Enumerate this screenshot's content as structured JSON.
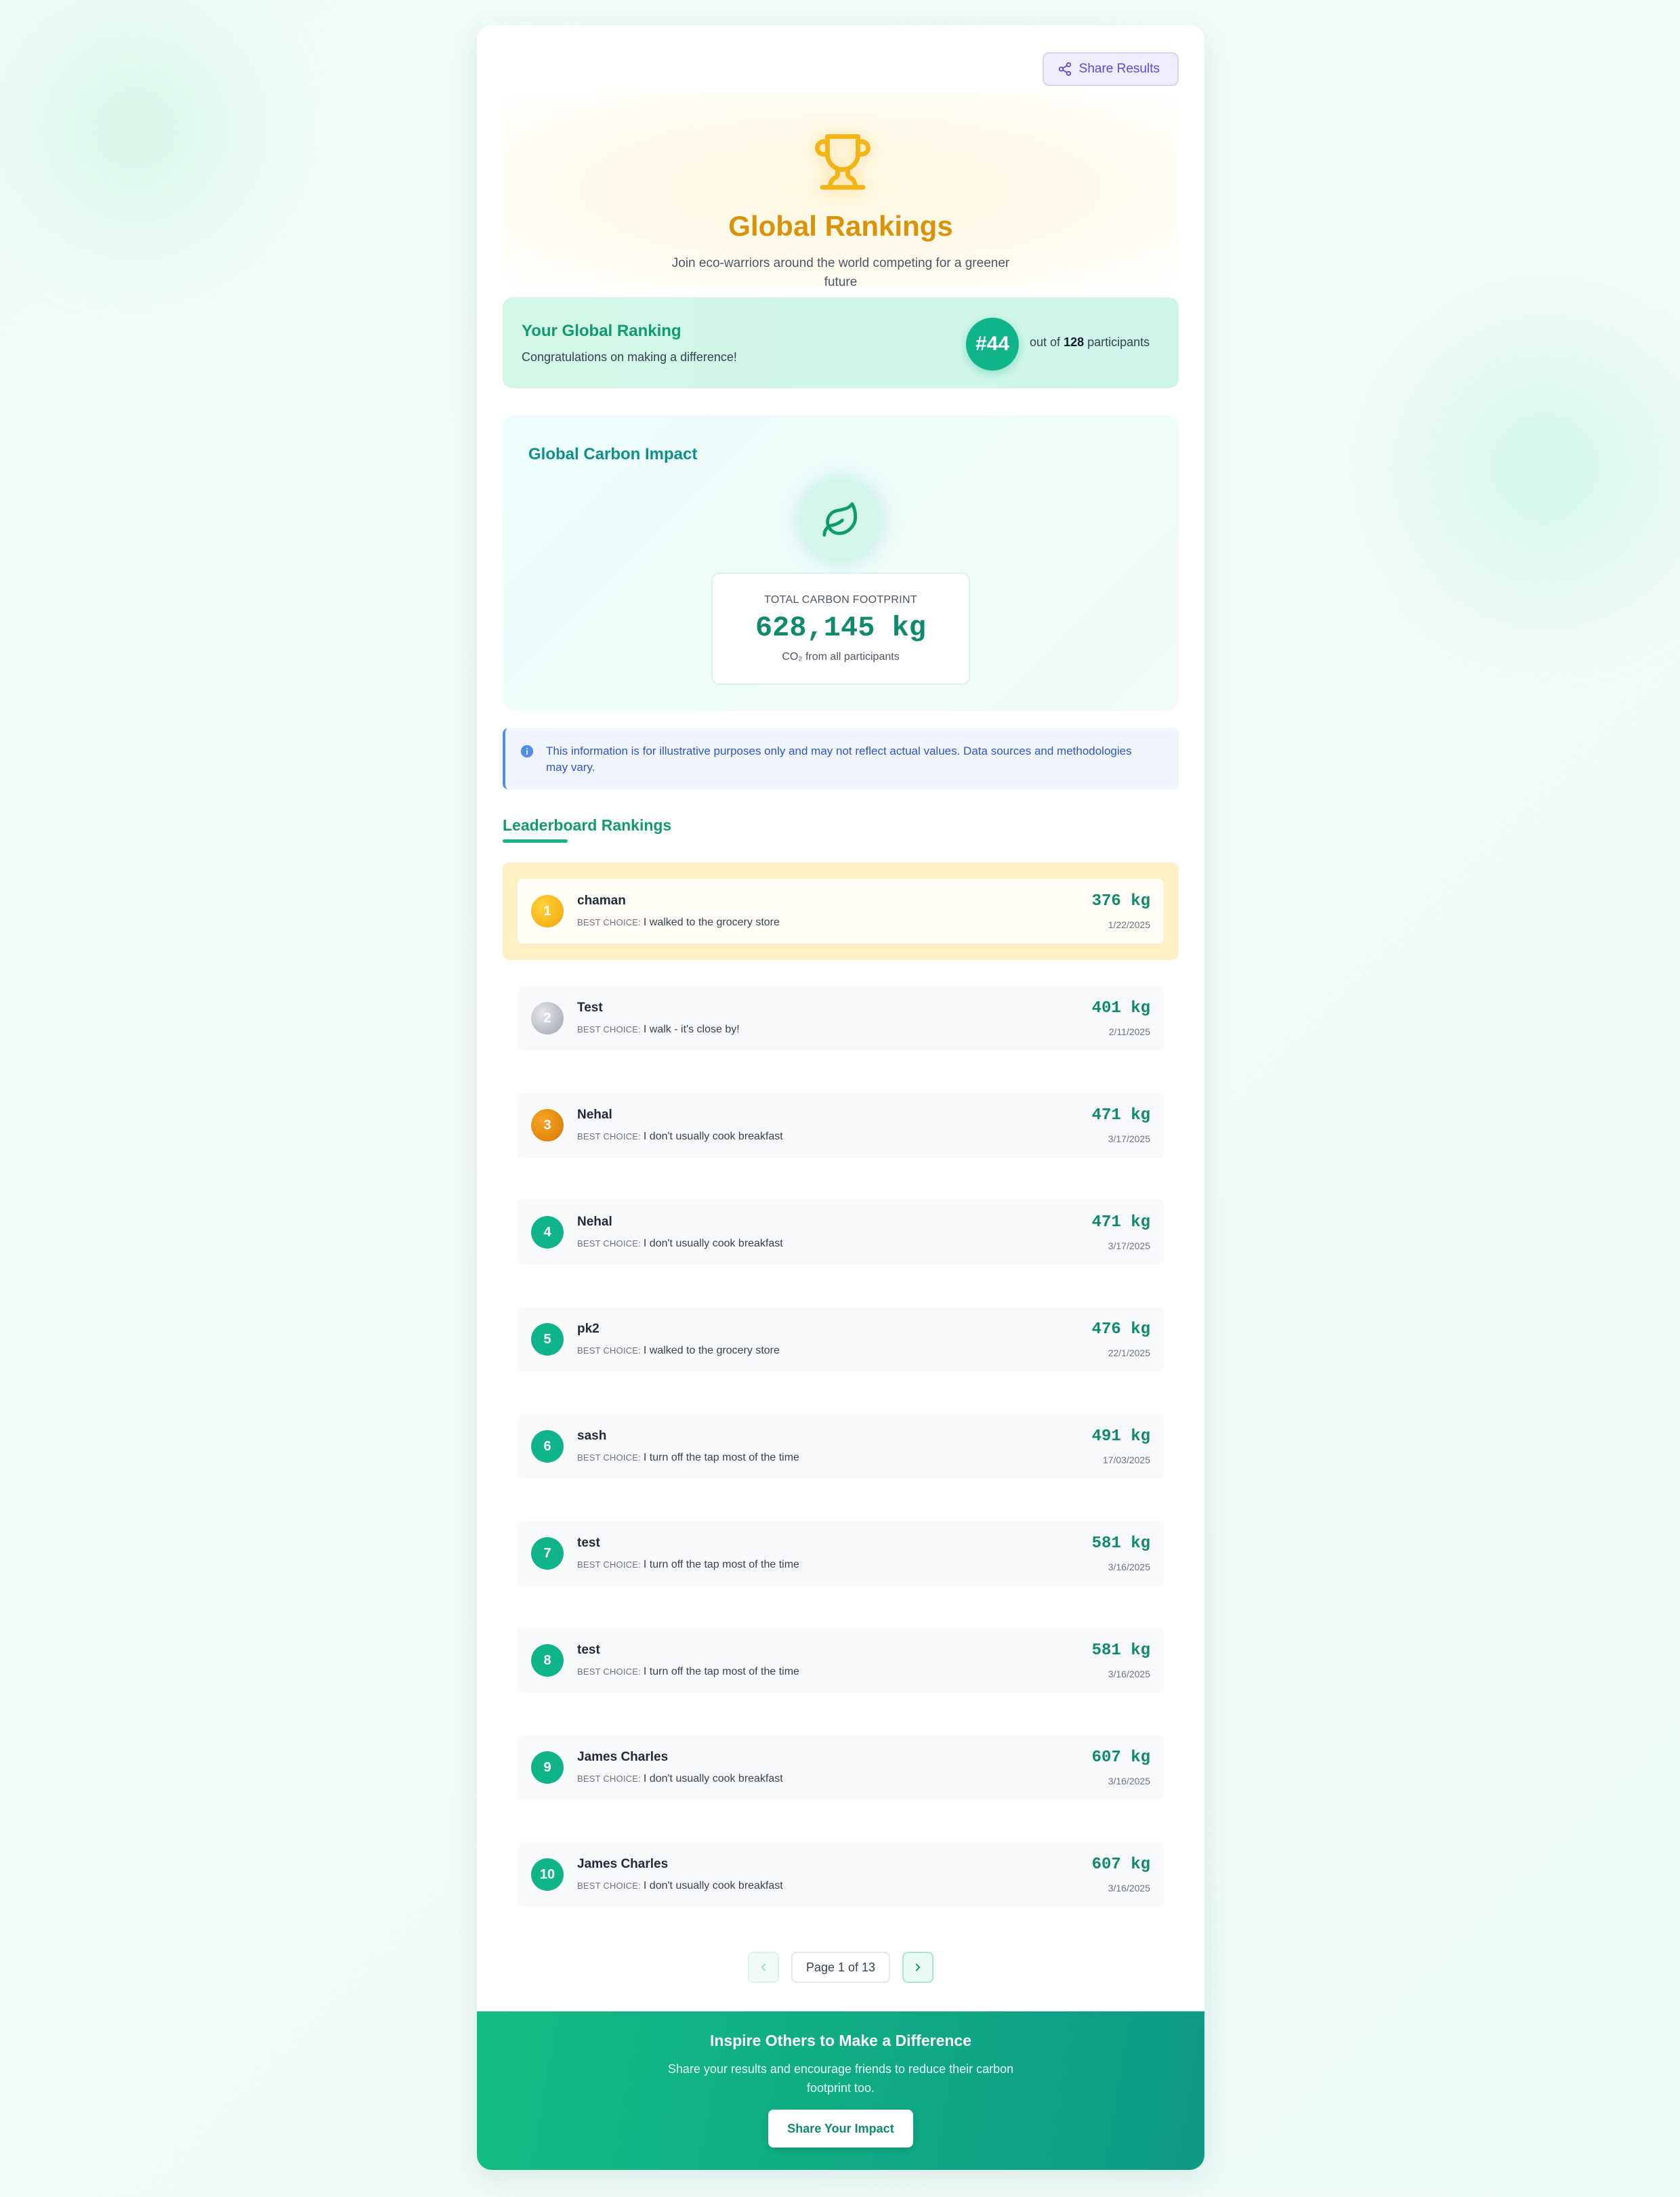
{
  "share_button": {
    "label": "Share Results"
  },
  "hero": {
    "icon": "trophy-icon",
    "title": "Global Rankings",
    "subtitle": "Join eco-warriors around the world competing for a greener future"
  },
  "your_ranking": {
    "title": "Your Global Ranking",
    "subtitle": "Congratulations on making a difference!",
    "rank": "#44",
    "out_of_prefix": "out of",
    "total": "128",
    "out_of_suffix": "participants"
  },
  "impact": {
    "title": "Global Carbon Impact",
    "icon": "leaf-icon",
    "total_label": "TOTAL CARBON FOOTPRINT",
    "total_value": "628,145 kg",
    "total_note": "CO₂ from all participants"
  },
  "info": {
    "icon": "info-icon",
    "text": "This information is for illustrative purposes only and may not reflect actual values. Data sources and methodologies may vary."
  },
  "leaderboard": {
    "title": "Leaderboard Rankings",
    "choice_label": "BEST CHOICE:",
    "entries": [
      {
        "rank": "1",
        "name": "chaman",
        "choice": "I walked to the grocery store",
        "kg": "376 kg",
        "date": "1/22/2025"
      },
      {
        "rank": "2",
        "name": "Test",
        "choice": "I walk - it's close by!",
        "kg": "401 kg",
        "date": "2/11/2025"
      },
      {
        "rank": "3",
        "name": "Nehal",
        "choice": "I don't usually cook breakfast",
        "kg": "471 kg",
        "date": "3/17/2025"
      },
      {
        "rank": "4",
        "name": "Nehal",
        "choice": "I don't usually cook breakfast",
        "kg": "471 kg",
        "date": "3/17/2025"
      },
      {
        "rank": "5",
        "name": "pk2",
        "choice": "I walked to the grocery store",
        "kg": "476 kg",
        "date": "22/1/2025"
      },
      {
        "rank": "6",
        "name": "sash",
        "choice": "I turn off the tap most of the time",
        "kg": "491 kg",
        "date": "17/03/2025"
      },
      {
        "rank": "7",
        "name": "test",
        "choice": "I turn off the tap most of the time",
        "kg": "581 kg",
        "date": "3/16/2025"
      },
      {
        "rank": "8",
        "name": "test",
        "choice": "I turn off the tap most of the time",
        "kg": "581 kg",
        "date": "3/16/2025"
      },
      {
        "rank": "9",
        "name": "James Charles",
        "choice": "I don't usually cook breakfast",
        "kg": "607 kg",
        "date": "3/16/2025"
      },
      {
        "rank": "10",
        "name": "James Charles",
        "choice": "I don't usually cook breakfast",
        "kg": "607 kg",
        "date": "3/16/2025"
      }
    ]
  },
  "pagination": {
    "label": "Page 1 of 13",
    "prev_icon": "chevron-left-icon",
    "next_icon": "chevron-right-icon"
  },
  "footer": {
    "title": "Inspire Others to Make a Difference",
    "subtitle": "Share your results and encourage friends to reduce their carbon footprint too.",
    "button": "Share Your Impact"
  },
  "colors": {
    "accent_green": "#10b48a",
    "gold": "#d9920a",
    "share_purple": "#5b4bd8",
    "info_blue": "#2f55c8"
  }
}
